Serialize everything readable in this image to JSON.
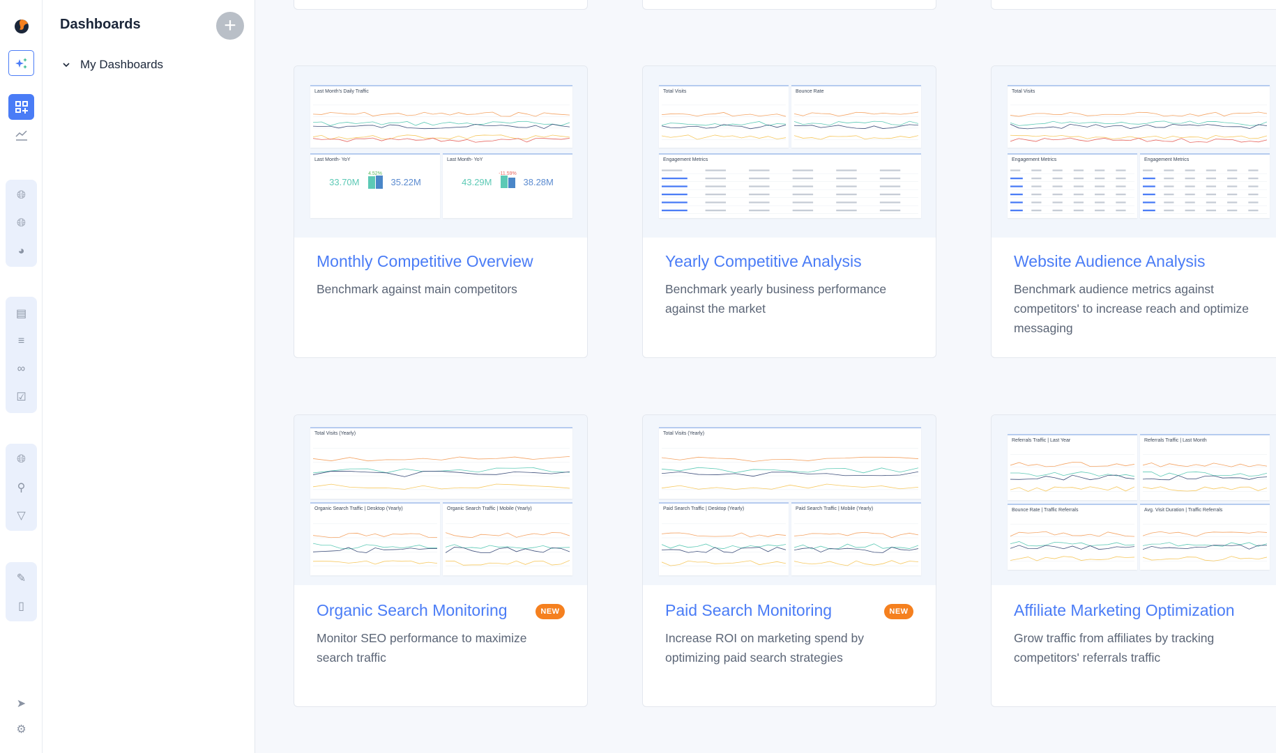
{
  "sidebar": {
    "title": "Dashboards",
    "add_label": "+",
    "tree": {
      "label": "My Dashboards"
    },
    "rail_icons": [
      "logo",
      "ai-assistant-icon",
      "dashboards-icon",
      "trends-icon",
      "globe-icon",
      "globe-trend-icon",
      "pie-chart-icon",
      "bar-chart-icon",
      "keyword-search-icon",
      "link-icon",
      "checklist-icon",
      "globe-trend-icon",
      "search-icon",
      "funnel-icon",
      "report-icon",
      "mobile-icon",
      "rocket-icon",
      "gear-icon"
    ]
  },
  "colors": {
    "accent": "#4a7cf6",
    "badge": "#f5801f",
    "lines": [
      "#f4a261",
      "#5cc9b5",
      "#3d4e7a",
      "#f6c85f",
      "#e8665f"
    ]
  },
  "cards": [
    {
      "title": "Monthly Competitive Overview",
      "desc": "Benchmark against main competitors",
      "panels": [
        "Last Month's Daily Traffic",
        "Last Month- YoY",
        "Last Month- YoY"
      ],
      "yoy": [
        {
          "from": "33.70M",
          "to": "35.22M",
          "change": "4.52%"
        },
        {
          "from": "43.29M",
          "to": "38.28M",
          "change": "-11.59%"
        }
      ]
    },
    {
      "title": "Yearly Competitive Analysis",
      "desc": "Benchmark yearly business performance against the market",
      "panels": [
        "Total Visits",
        "Bounce Rate",
        "Engagement Metrics"
      ]
    },
    {
      "title": "Website Audience Analysis",
      "desc": "Benchmark audience metrics against competitors' to increase reach and optimize messaging",
      "panels": [
        "Total Visits",
        "Engagement Metrics",
        "Engagement Metrics"
      ]
    },
    {
      "title": "Organic Search Monitoring",
      "desc": "Monitor SEO performance to maximize search traffic",
      "badge": "NEW",
      "panels": [
        "Total Visits (Yearly)",
        "Organic Search Traffic | Desktop (Yearly)",
        "Organic Search Traffic | Mobile (Yearly)"
      ]
    },
    {
      "title": "Paid Search Monitoring",
      "desc": "Increase ROI on marketing spend by optimizing paid search strategies",
      "badge": "NEW",
      "panels": [
        "Total Visits (Yearly)",
        "Paid Search Traffic | Desktop (Yearly)",
        "Paid Search Traffic | Mobile (Yearly)"
      ]
    },
    {
      "title": "Affiliate Marketing Optimization",
      "desc": "Grow traffic from affiliates by tracking competitors' referrals traffic",
      "panels": [
        "Referrals Traffic | Last Year",
        "Referrals Traffic | Last Month",
        "Bounce Rate | Traffic Referrals",
        "Avg. Visit Duration | Traffic Referrals"
      ]
    }
  ]
}
